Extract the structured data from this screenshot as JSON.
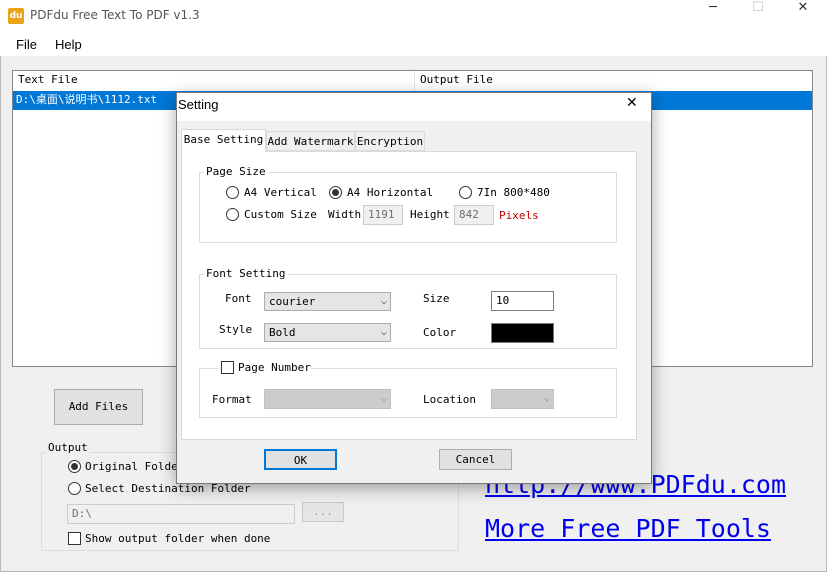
{
  "window": {
    "title": "PDFdu Free Text To PDF  v1.3",
    "icon_text": "du",
    "minimize": "─",
    "maximize": "☐",
    "close": "✕"
  },
  "menu": {
    "file": "File",
    "help": "Help"
  },
  "file_list": {
    "columns": [
      "Text File",
      "Output File"
    ],
    "rows": [
      {
        "text_file": "D:\\桌面\\说明书\\1112.txt",
        "output_file": ""
      }
    ]
  },
  "add_files_label": "Add Files",
  "output": {
    "group_label": "Output",
    "original_folder": "Original Folder",
    "select_destination": "Select Destination Folder",
    "path_value": "D:\\",
    "browse_label": "...",
    "show_folder": "Show output folder when done"
  },
  "links": {
    "site": "http://www.PDFdu.com",
    "more_tools": "More Free PDF Tools"
  },
  "dialog": {
    "title": "Setting",
    "close": "✕",
    "tabs": [
      "Base Setting",
      "Add Watermark",
      "Encryption"
    ],
    "page_size": {
      "label": "Page Size",
      "a4_vertical": "A4 Vertical",
      "a4_horizontal": "A4 Horizontal",
      "seven_in": "7In 800*480",
      "custom_size": "Custom Size",
      "width_label": "Width",
      "width_value": "1191",
      "height_label": "Height",
      "height_value": "842",
      "unit": "Pixels",
      "selected": "a4_horizontal"
    },
    "font_setting": {
      "label": "Font Setting",
      "font_label": "Font",
      "font_value": "courier",
      "size_label": "Size",
      "size_value": "10",
      "style_label": "Style",
      "style_value": "Bold",
      "color_label": "Color",
      "color_value": "#000000"
    },
    "page_number": {
      "label": "Page Number",
      "checked": false,
      "format_label": "Format",
      "format_value": "",
      "location_label": "Location",
      "location_value": ""
    },
    "ok_label": "OK",
    "cancel_label": "Cancel"
  },
  "colors": {
    "selection": "#0078d7",
    "link": "#0000ee",
    "pixels_unit": "#c00000"
  }
}
